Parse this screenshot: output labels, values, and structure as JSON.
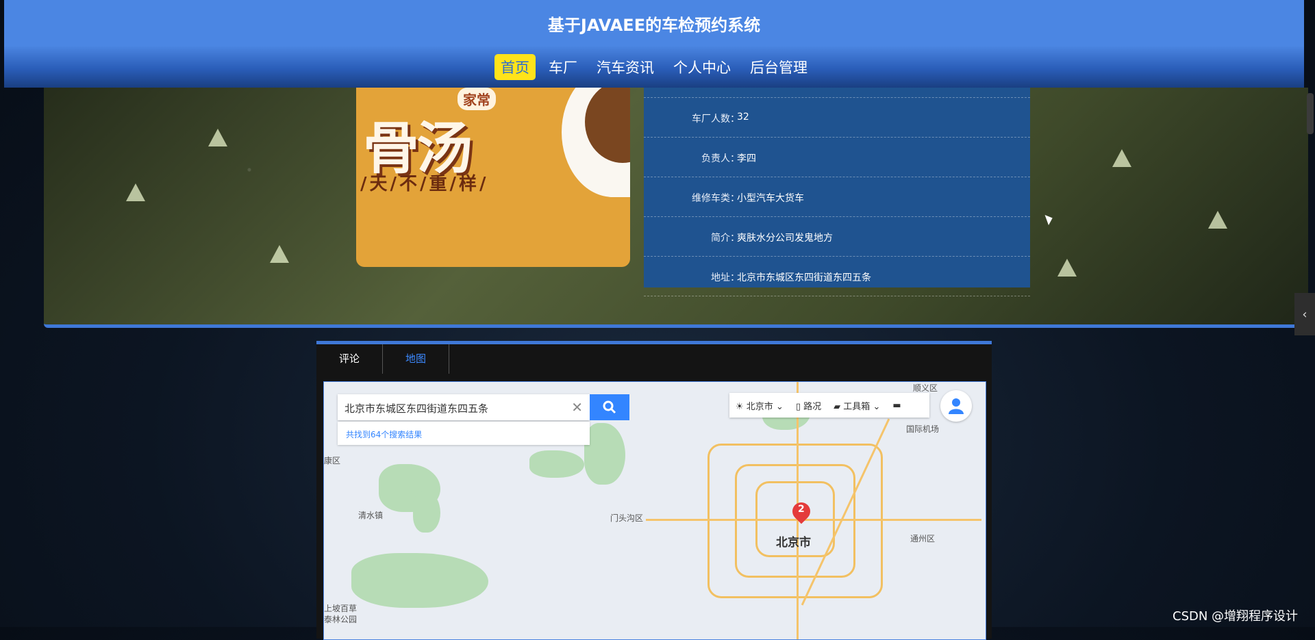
{
  "header": {
    "title": "基于JAVAEE的车检预约系统"
  },
  "nav": {
    "items": [
      "首页",
      "车厂",
      "汽车资讯",
      "个人中心",
      "后台管理"
    ],
    "active_index": 0
  },
  "poster": {
    "tag": "家常",
    "big_text": "骨汤",
    "slogan": "/天/不/重/样/"
  },
  "info": {
    "rows": [
      {
        "label": "车厂人数：",
        "value": "32"
      },
      {
        "label": "负责人：",
        "value": "李四"
      },
      {
        "label": "维修车类：",
        "value": "小型汽车大货车"
      },
      {
        "label": "简介：",
        "value": "爽肤水分公司发鬼地方"
      },
      {
        "label": "地址：",
        "value": "北京市东城区东四街道东四五条"
      }
    ]
  },
  "tabs": {
    "items": [
      "评论",
      "地图"
    ],
    "active_index": 1
  },
  "map": {
    "search_value": "北京市东城区东四街道东四五条",
    "results_text": "共找到64个搜索结果",
    "toolbar": {
      "city": "北京市",
      "traffic": "路况",
      "toolbox": "工具箱"
    },
    "labels": [
      "顺义区",
      "国际机场",
      "清水镇",
      "门头沟区",
      "北京市",
      "通州区",
      "康区",
      "上坡百草",
      "泰林公园"
    ],
    "pin_number": "2"
  },
  "watermark": "CSDN @增翔程序设计"
}
